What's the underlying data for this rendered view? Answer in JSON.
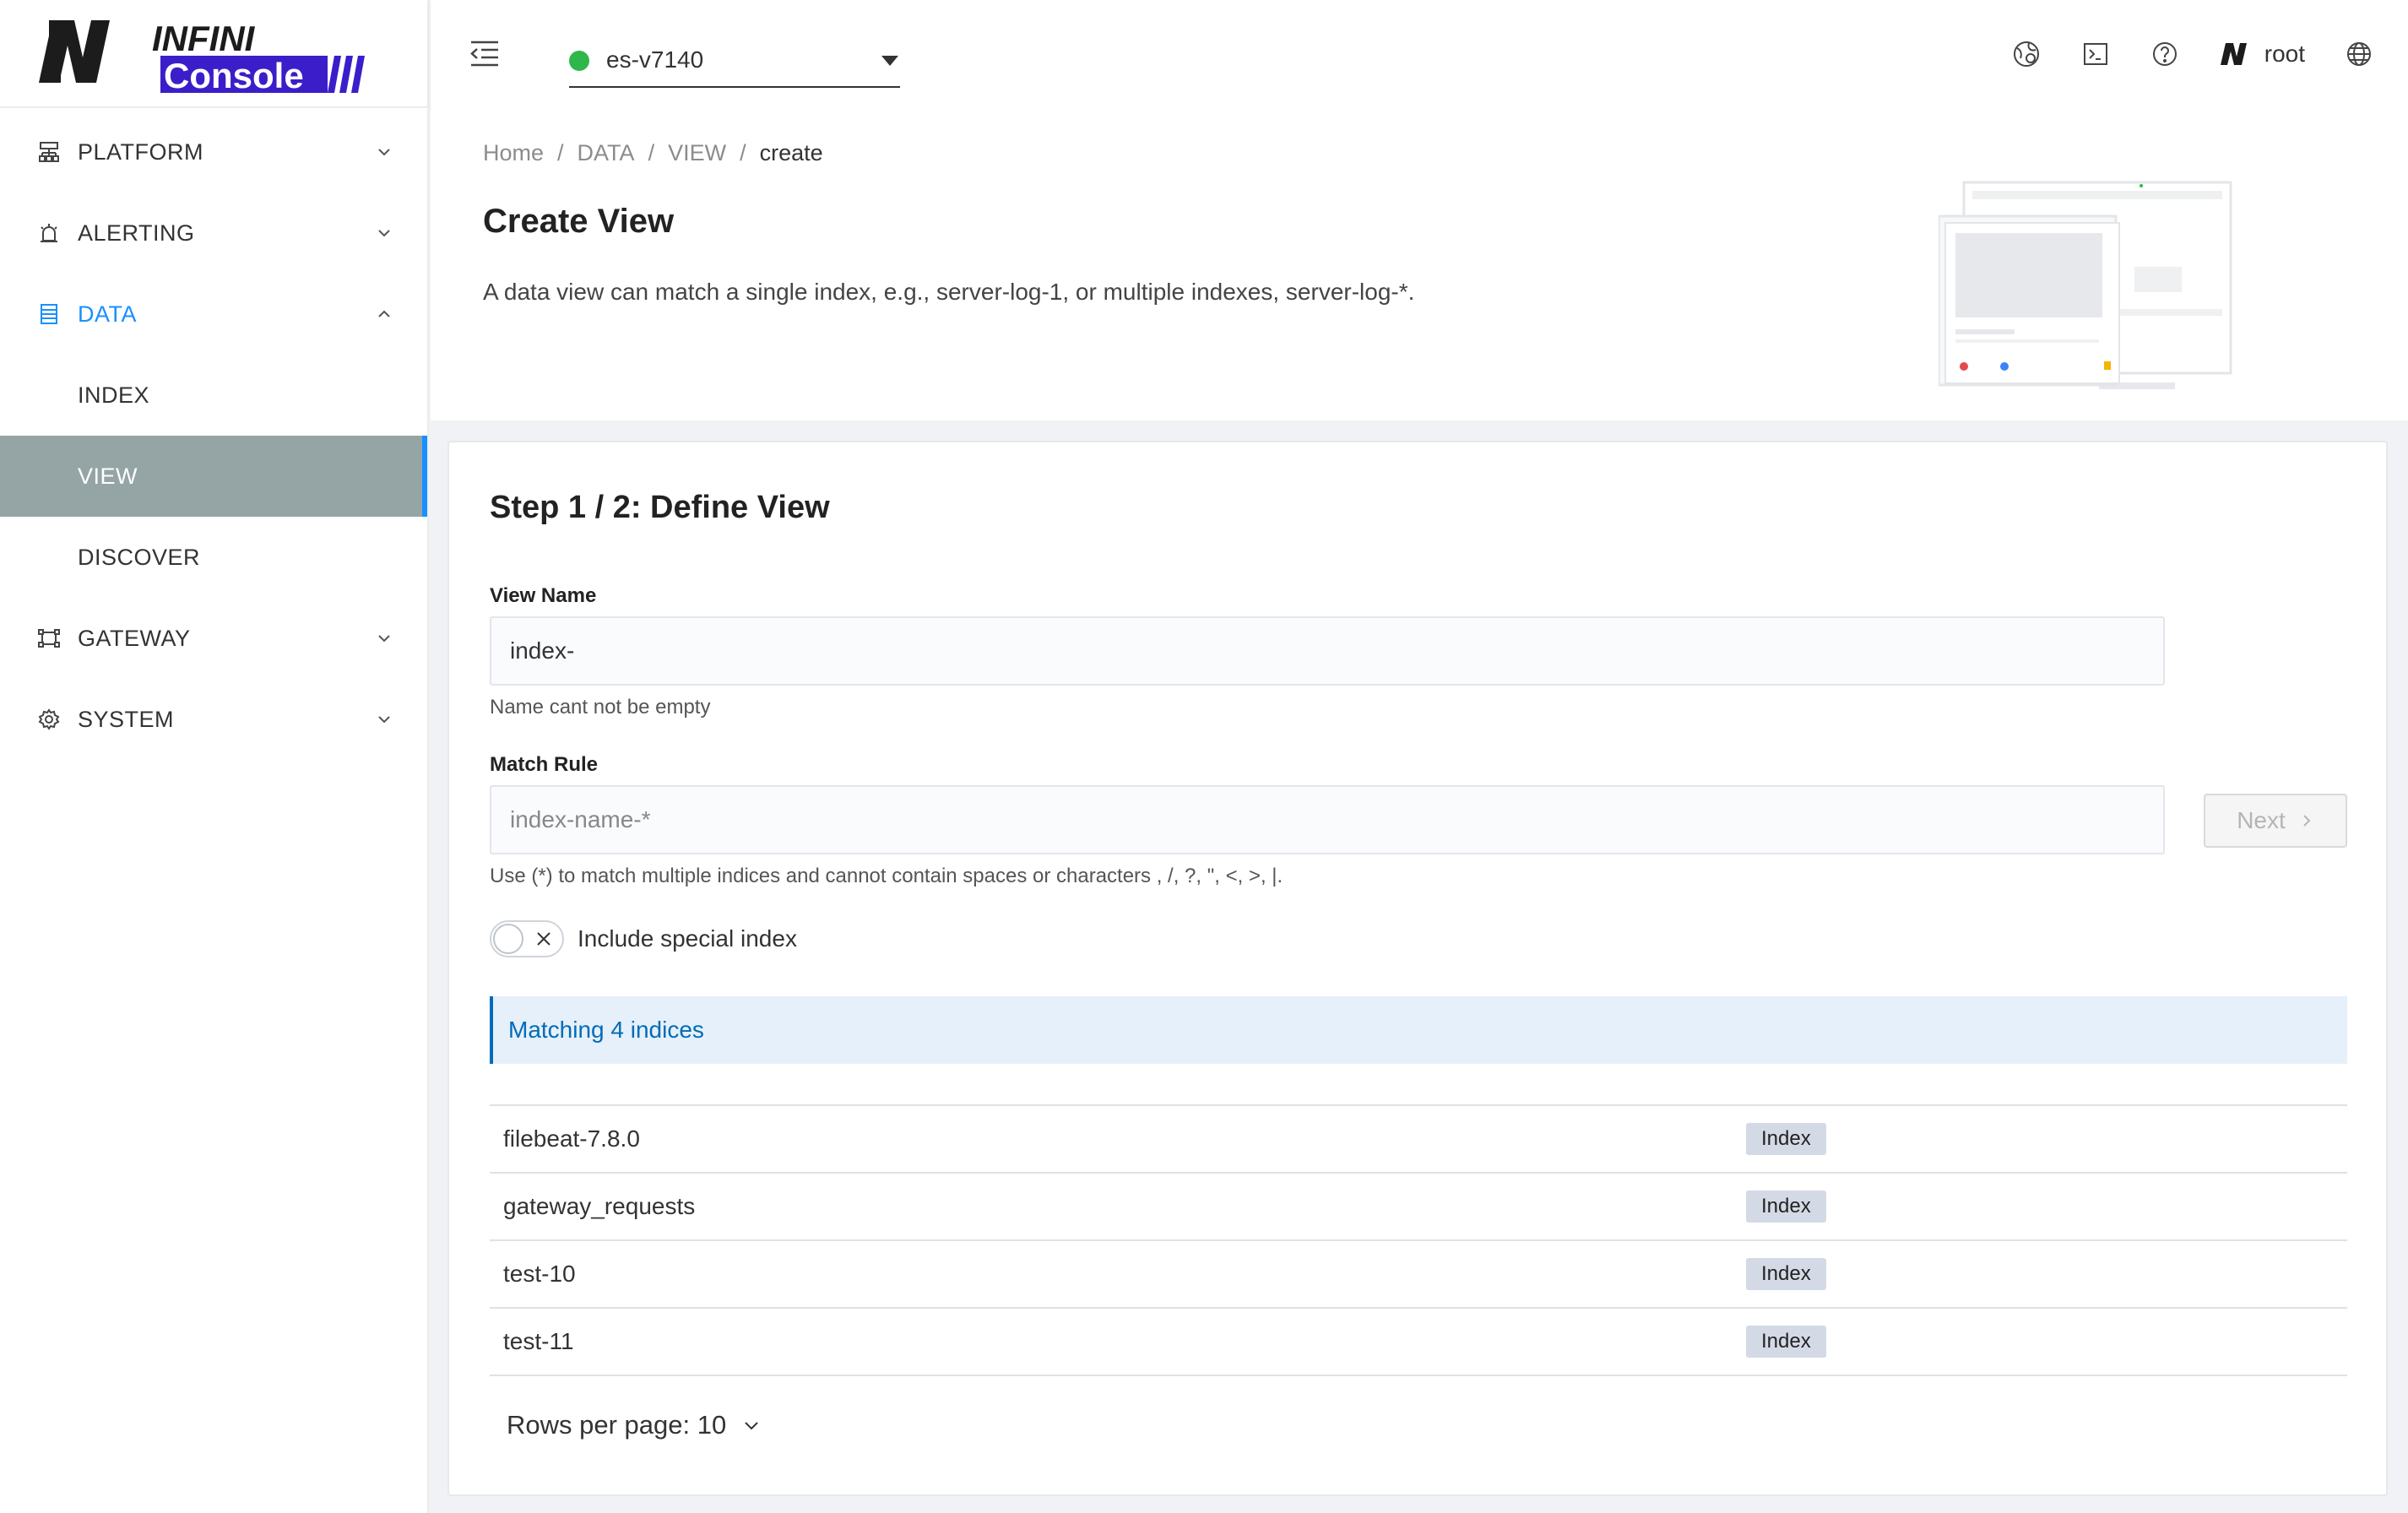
{
  "brand": {
    "line1": "INFINI",
    "line2": "Console",
    "accent": "#3b1ec9"
  },
  "sidebar": {
    "items": [
      {
        "label": "PLATFORM",
        "icon": "cluster-icon"
      },
      {
        "label": "ALERTING",
        "icon": "alarm-icon"
      },
      {
        "label": "DATA",
        "icon": "database-icon",
        "expanded": true
      },
      {
        "label": "INDEX"
      },
      {
        "label": "VIEW",
        "selected": true
      },
      {
        "label": "DISCOVER"
      },
      {
        "label": "GATEWAY",
        "icon": "gateway-icon"
      },
      {
        "label": "SYSTEM",
        "icon": "gear-icon"
      }
    ]
  },
  "header": {
    "cluster_name": "es-v7140",
    "cluster_status_color": "#2eb84b",
    "user": "root"
  },
  "breadcrumb": [
    "Home",
    "DATA",
    "VIEW",
    "create"
  ],
  "page": {
    "title": "Create View",
    "description": "A data view can match a single index, e.g., server-log-1, or multiple indexes, server-log-*."
  },
  "form": {
    "step_title": "Step 1 / 2: Define View",
    "view_name_label": "View Name",
    "view_name_value": "index-",
    "view_name_help": "Name cant not be empty",
    "match_rule_label": "Match Rule",
    "match_rule_placeholder": "index-name-*",
    "match_rule_help": "Use (*) to match multiple indices and cannot contain spaces or characters , /, ?, \", <, >, |.",
    "next_label": "Next",
    "toggle_label": "Include special index",
    "toggle_on": false
  },
  "matching": {
    "callout": "Matching 4 indices",
    "rows": [
      {
        "name": "filebeat-7.8.0",
        "type": "Index"
      },
      {
        "name": "gateway_requests",
        "type": "Index"
      },
      {
        "name": "test-10",
        "type": "Index"
      },
      {
        "name": "test-11",
        "type": "Index"
      }
    ],
    "rows_per_page": "Rows per page: 10"
  }
}
